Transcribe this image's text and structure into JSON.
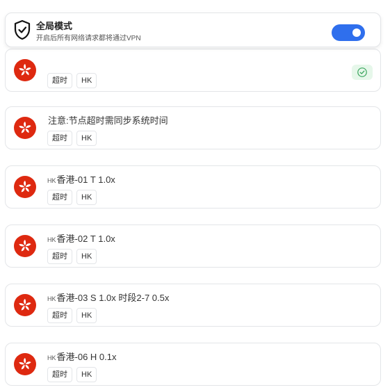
{
  "global_mode": {
    "title": "全局模式",
    "subtitle": "开启后所有网络请求都将通过VPN",
    "enabled": true,
    "accent_color": "#2f6fed"
  },
  "nodes": [
    {
      "code": "",
      "name": "",
      "tags": [
        "超时",
        "HK"
      ],
      "flag": "hong-kong-flag-icon",
      "selected": true
    },
    {
      "code": "",
      "name": "注意:节点超时需同步系统时间",
      "tags": [
        "超时",
        "HK"
      ],
      "flag": "hong-kong-flag-icon"
    },
    {
      "code": "HK",
      "name": "香港-01 T 1.0x",
      "tags": [
        "超时",
        "HK"
      ],
      "flag": "hong-kong-flag-icon"
    },
    {
      "code": "HK",
      "name": "香港-02 T 1.0x",
      "tags": [
        "超时",
        "HK"
      ],
      "flag": "hong-kong-flag-icon"
    },
    {
      "code": "HK",
      "name": "香港-03 S 1.0x 时段2-7 0.5x",
      "tags": [
        "超时",
        "HK"
      ],
      "flag": "hong-kong-flag-icon"
    },
    {
      "code": "HK",
      "name": "香港-06 H 0.1x",
      "tags": [
        "超时",
        "HK"
      ],
      "flag": "hong-kong-flag-icon"
    }
  ],
  "colors": {
    "flag_red": "#de2910",
    "selected_badge": "#e6f7ea",
    "check_green": "#3aa55d"
  }
}
